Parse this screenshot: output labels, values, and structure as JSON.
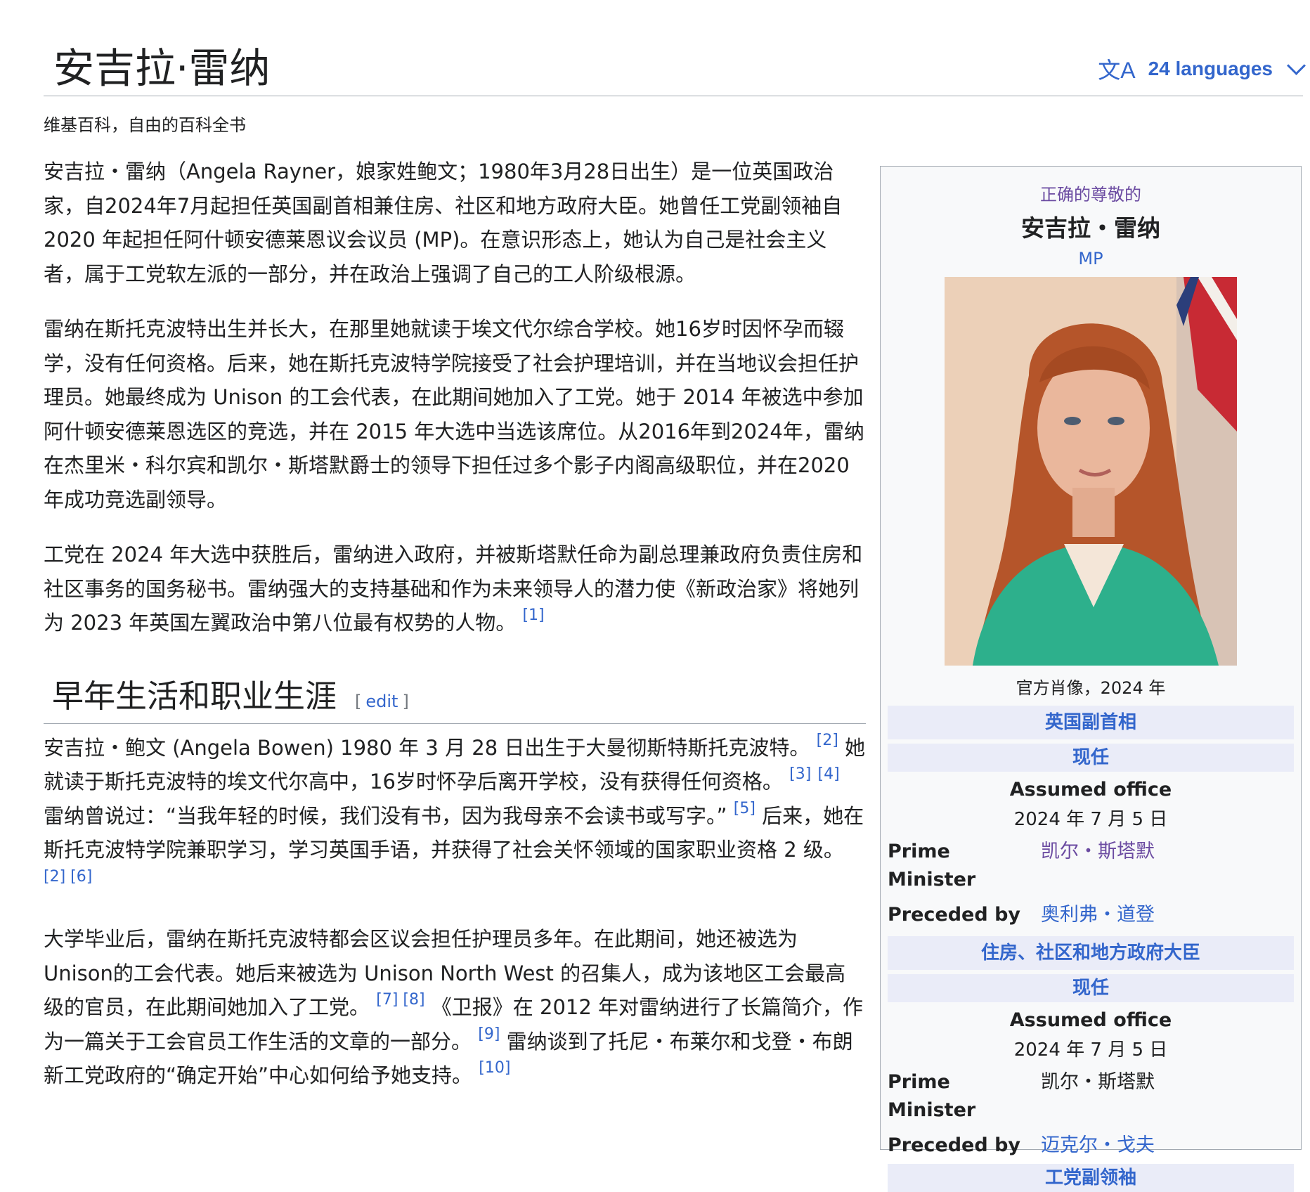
{
  "page": {
    "title": "安吉拉·雷纳",
    "languages_label": "24 languages",
    "tagline": "维基百科，自由的百科全书"
  },
  "intro": {
    "p1": "安吉拉・雷纳（Angela Rayner，娘家姓鲍文；1980年3月28日出生）是一位英国政治家，自2024年7月起担任英国副首相兼住房、社区和地方政府大臣。她曾任工党副领袖自 2020 年起担任阿什顿安德莱恩议会议员 (MP)。在意识形态上，她认为自己是社会主义者，属于工党软左派的一部分，并在政治上强调了自己的工人阶级根源。",
    "p2": "雷纳在斯托克波特出生并长大，在那里她就读于埃文代尔综合学校。她16岁时因怀孕而辍学，没有任何资格。后来，她在斯托克波特学院接受了社会护理培训，并在当地议会担任护理员。她最终成为 Unison 的工会代表，在此期间她加入了工党。她于 2014 年被选中参加阿什顿安德莱恩选区的竞选，并在 2015 年大选中当选该席位。从2016年到2024年，雷纳在杰里米・科尔宾和凯尔・斯塔默爵士的领导下担任过多个影子内阁高级职位，并在2020年成功竞选副领导。",
    "p3": "工党在 2024 年大选中获胜后，雷纳进入政府，并被斯塔默任命为副总理兼政府负责住房和社区事务的国务秘书。雷纳强大的支持基础和作为未来领导人的潜力使《新政治家》将她列为 2023 年英国左翼政治中第八位最有权势的人物。",
    "p3_ref": "[1]"
  },
  "section1": {
    "heading": "早年生活和职业生涯",
    "edit_open": "[",
    "edit_label": "edit",
    "edit_close": "]",
    "p1_a": "安吉拉・鲍文 (Angela Bowen) 1980 年 3 月 28 日出生于大曼彻斯特斯托克波特。",
    "ref2": "[2]",
    "p1_b": "她就读于斯托克波特的埃文代尔高中，16岁时怀孕后离开学校，没有获得任何资格。",
    "ref3": "[3]",
    "ref4": "[4]",
    "p1_c": "雷纳曾说过：“当我年轻的时候，我们没有书，因为我母亲不会读书或写字。”",
    "ref5": "[5]",
    "p1_d": "后来，她在斯托克波特学院兼职学习，学习英国手语，并获得了社会关怀领域的国家职业资格 2 级。",
    "ref2b": "[2]",
    "ref6": "[6]",
    "p2_a": "大学毕业后，雷纳在斯托克波特都会区议会担任护理员多年。在此期间，她还被选为Unison的工会代表。她后来被选为 Unison North West 的召集人，成为该地区工会最高级的官员，在此期间她加入了工党。",
    "ref7": "[7]",
    "ref8": "[8]",
    "p2_b": "《卫报》在 2012 年对雷纳进行了长篇简介，作为一篇关于工会官员工作生活的文章的一部分。",
    "ref9": "[9]",
    "p2_c": "雷纳谈到了托尼・布莱尔和戈登・布朗新工党政府的“确定开始”中心如何给予她支持。",
    "ref10": "[10]"
  },
  "infobox": {
    "honorific": "正确的尊敬的",
    "name": "安吉拉・雷纳",
    "post_nominal": "MP",
    "caption": "官方肖像，2024 年",
    "office1": {
      "title": "英国副首相",
      "status": "现任",
      "assumed_label": "Assumed office",
      "assumed_date": "2024 年 7 月 5 日",
      "pm_label": "Prime Minister",
      "pm_value": "凯尔・斯塔默",
      "preceded_label": "Preceded by",
      "preceded_value": "奥利弗・道登"
    },
    "office2": {
      "title": "住房、社区和地方政府大臣",
      "status": "现任",
      "assumed_label": "Assumed office",
      "assumed_date": "2024 年 7 月 5 日",
      "pm_label": "Prime Minister",
      "pm_value": "凯尔・斯塔默",
      "preceded_label": "Preceded by",
      "preceded_value": "迈克尔・戈夫"
    },
    "office3": {
      "title": "工党副领袖"
    }
  },
  "colors": {
    "link": "#3366cc",
    "visited_link": "#6b4ba1",
    "infobox_band": "#eaecf8",
    "jacket": "#2db08c",
    "hair": "#b5552a"
  }
}
